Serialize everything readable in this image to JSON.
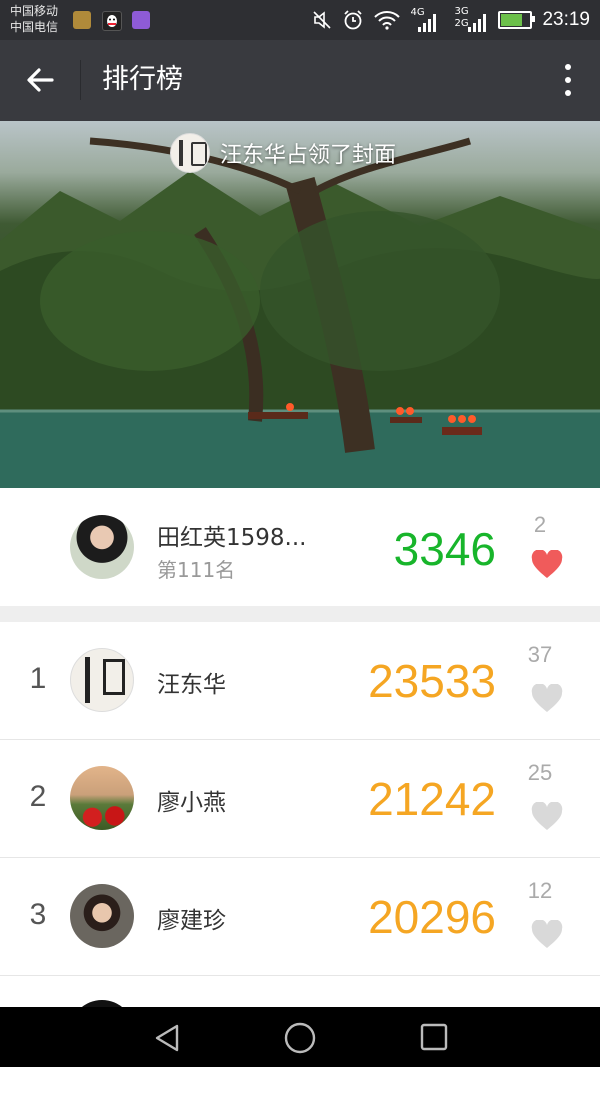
{
  "status_bar": {
    "carrier_1": "中国移动",
    "carrier_2": "中国电信",
    "network_1": "4G",
    "network_2": "3G",
    "network_3": "2G",
    "time": "23:19",
    "battery_level": 0.8
  },
  "header": {
    "title": "排行榜"
  },
  "cover": {
    "banner_text": "汪东华占领了封面"
  },
  "my_rank": {
    "name": "田红英1598...",
    "rank_text": "第111名",
    "score": "3346",
    "likes": "2",
    "liked": true
  },
  "ranking": [
    {
      "rank": "1",
      "name": "汪东华",
      "score": "23533",
      "likes": "37"
    },
    {
      "rank": "2",
      "name": "廖小燕",
      "score": "21242",
      "likes": "25"
    },
    {
      "rank": "3",
      "name": "廖建珍",
      "score": "20296",
      "likes": "12"
    }
  ],
  "colors": {
    "my_score": "#18b52b",
    "rank_score": "#f5a623",
    "heart_active": "#f05b5b",
    "heart_inactive": "#d9d9d9",
    "app_bar": "#393a3f"
  }
}
